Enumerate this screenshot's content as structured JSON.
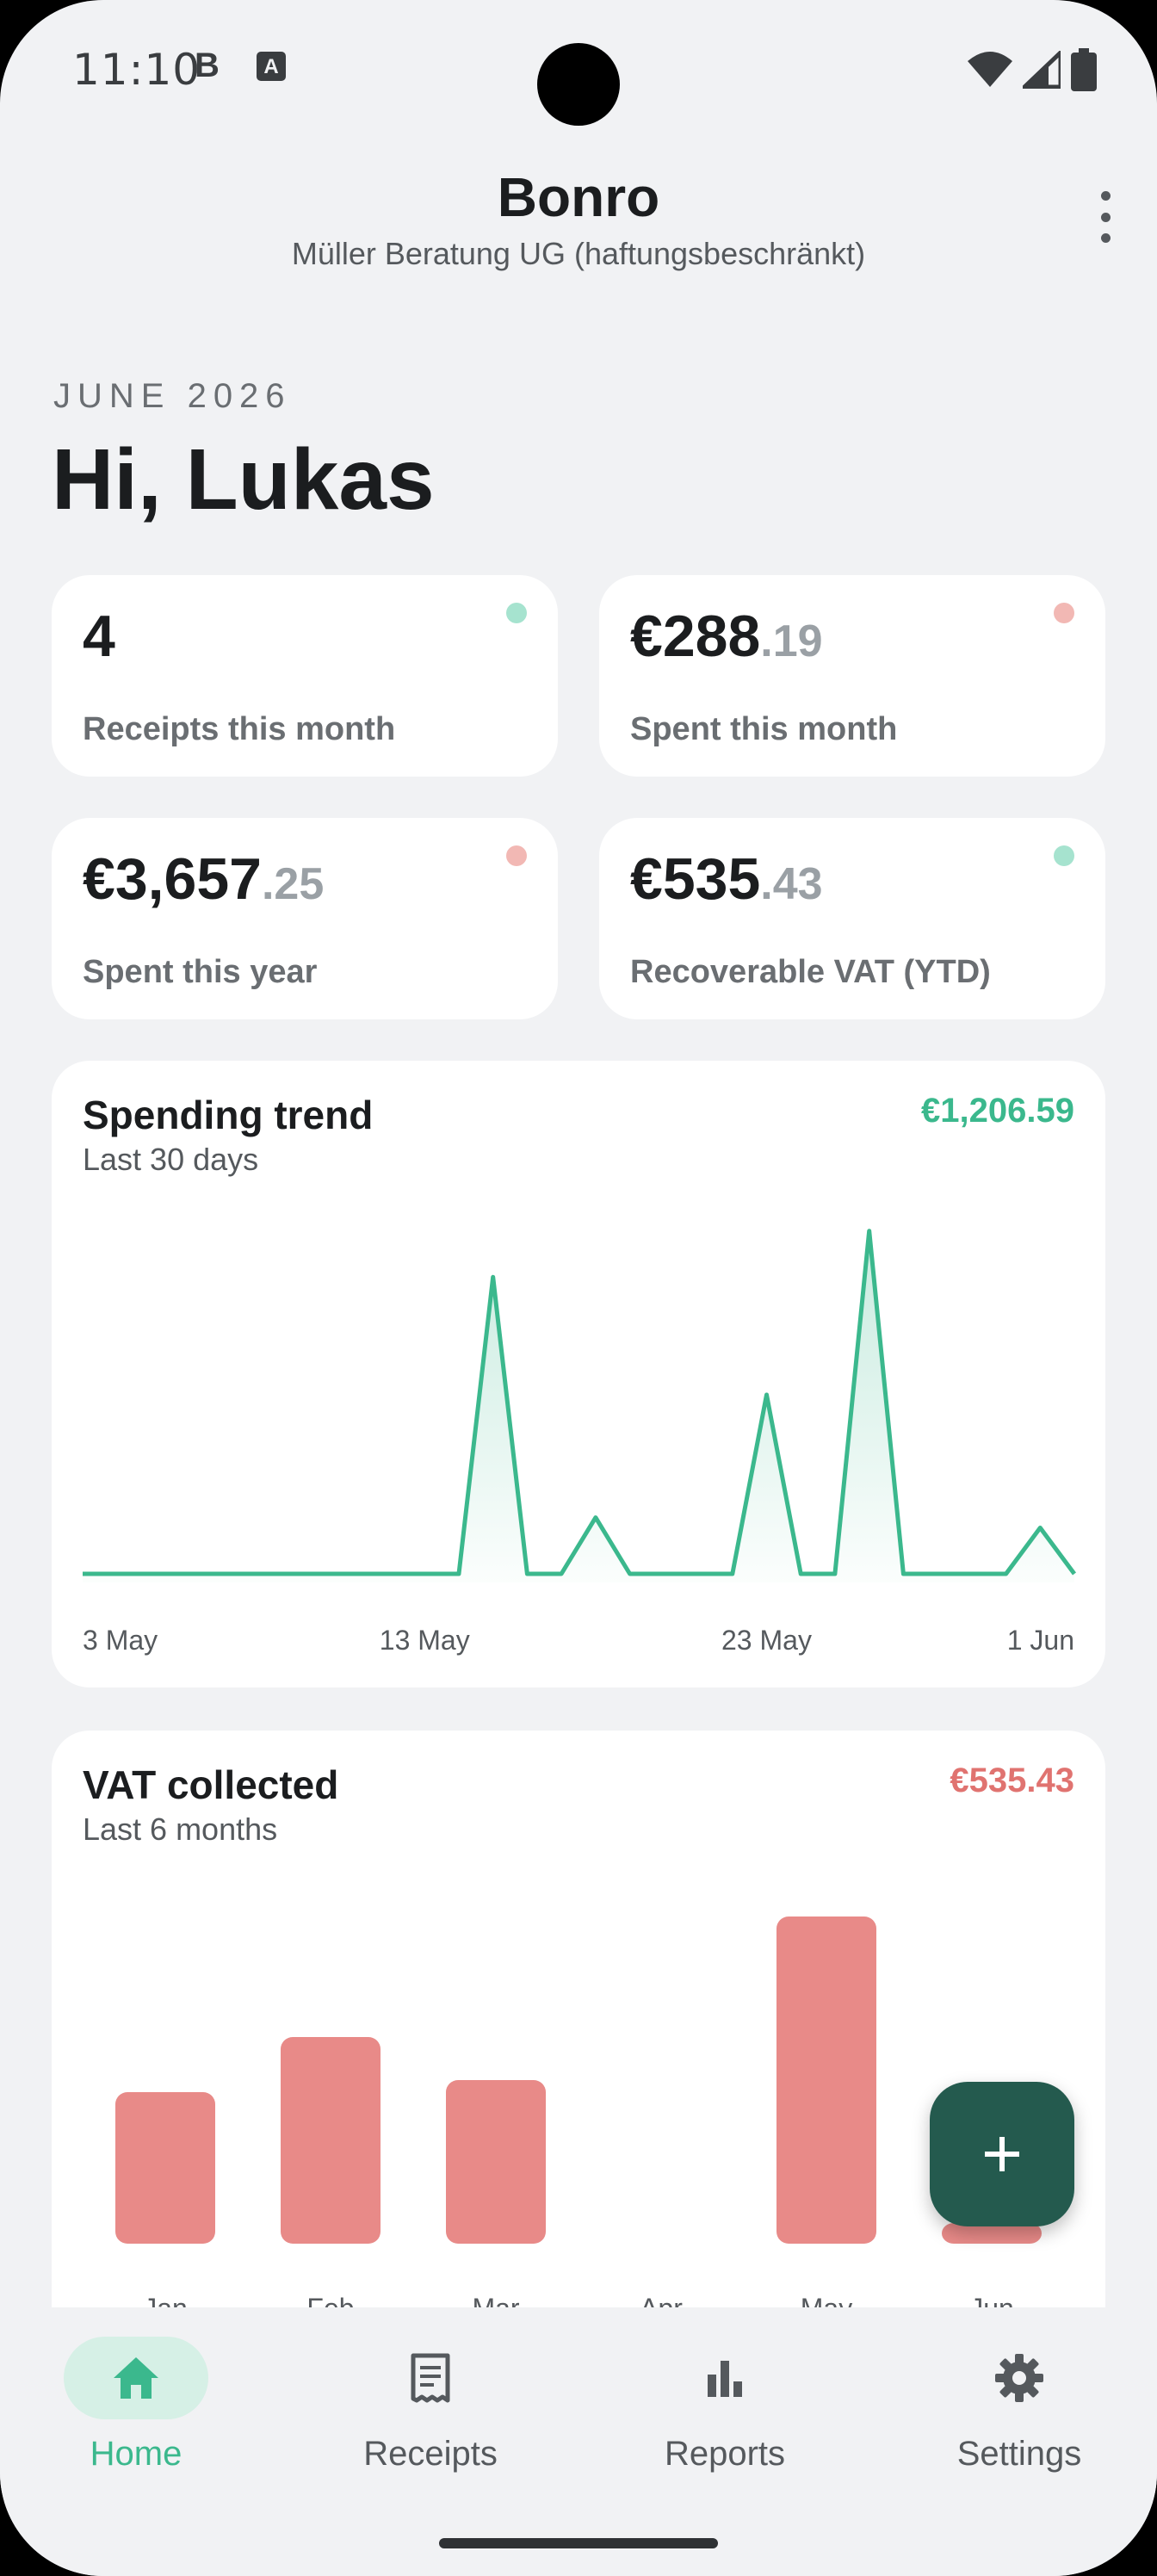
{
  "status_bar": {
    "time": "11:10",
    "notif_b": "B",
    "notif_a": "A"
  },
  "header": {
    "title": "Bonro",
    "subtitle": "Müller Beratung UG (haftungsbeschränkt)"
  },
  "month_label": "JUNE 2026",
  "greeting": "Hi, Lukas",
  "stats": [
    {
      "value": "4",
      "cents": "",
      "label": "Receipts this month",
      "dot_color": "#a6e3cf"
    },
    {
      "value": "€288",
      "cents": ".19",
      "label": "Spent this month",
      "dot_color": "#f2b8b4"
    },
    {
      "value": "€3,657",
      "cents": ".25",
      "label": "Spent this year",
      "dot_color": "#f2b8b4"
    },
    {
      "value": "€535",
      "cents": ".43",
      "label": "Recoverable VAT (YTD)",
      "dot_color": "#a6e3cf"
    }
  ],
  "spending_card": {
    "title": "Spending trend",
    "subtitle": "Last 30 days",
    "total": "€1,206.59"
  },
  "vat_card": {
    "title": "VAT collected",
    "subtitle": "Last 6 months",
    "total": "€535.43"
  },
  "chart_data": [
    {
      "type": "area",
      "title": "Spending trend",
      "x_tick_labels": [
        "3 May",
        "13 May",
        "23 May",
        "1 Jun"
      ],
      "x": [
        "3 May",
        "4 May",
        "5 May",
        "6 May",
        "7 May",
        "8 May",
        "9 May",
        "10 May",
        "11 May",
        "12 May",
        "13 May",
        "14 May",
        "15 May",
        "16 May",
        "17 May",
        "18 May",
        "19 May",
        "20 May",
        "21 May",
        "22 May",
        "23 May",
        "24 May",
        "25 May",
        "26 May",
        "27 May",
        "28 May",
        "29 May",
        "30 May",
        "31 May",
        "1 Jun"
      ],
      "values": [
        0,
        0,
        0,
        0,
        0,
        0,
        0,
        0,
        0,
        0,
        0,
        0,
        290,
        0,
        0,
        55,
        0,
        0,
        0,
        0,
        175,
        0,
        0,
        335,
        0,
        0,
        0,
        0,
        45,
        0
      ],
      "color": "#3bb88d",
      "ylim": [
        0,
        350
      ]
    },
    {
      "type": "bar",
      "title": "VAT collected",
      "categories": [
        "Jan",
        "Feb",
        "Mar",
        "Apr",
        "May",
        "Jun"
      ],
      "values": [
        88,
        120,
        95,
        0,
        190,
        12
      ],
      "color": "#e88a88",
      "ylim": [
        0,
        200
      ]
    }
  ],
  "fab": {
    "icon": "plus-icon"
  },
  "nav": [
    {
      "label": "Home",
      "icon": "home-icon",
      "active": true
    },
    {
      "label": "Receipts",
      "icon": "receipt-icon",
      "active": false
    },
    {
      "label": "Reports",
      "icon": "bar-chart-icon",
      "active": false
    },
    {
      "label": "Settings",
      "icon": "gear-icon",
      "active": false
    }
  ],
  "colors": {
    "accent": "#3bb88d",
    "accent_dark": "#245a4e",
    "vat_red": "#e07370",
    "bar_red": "#e88a88",
    "background": "#f1f2f4"
  }
}
